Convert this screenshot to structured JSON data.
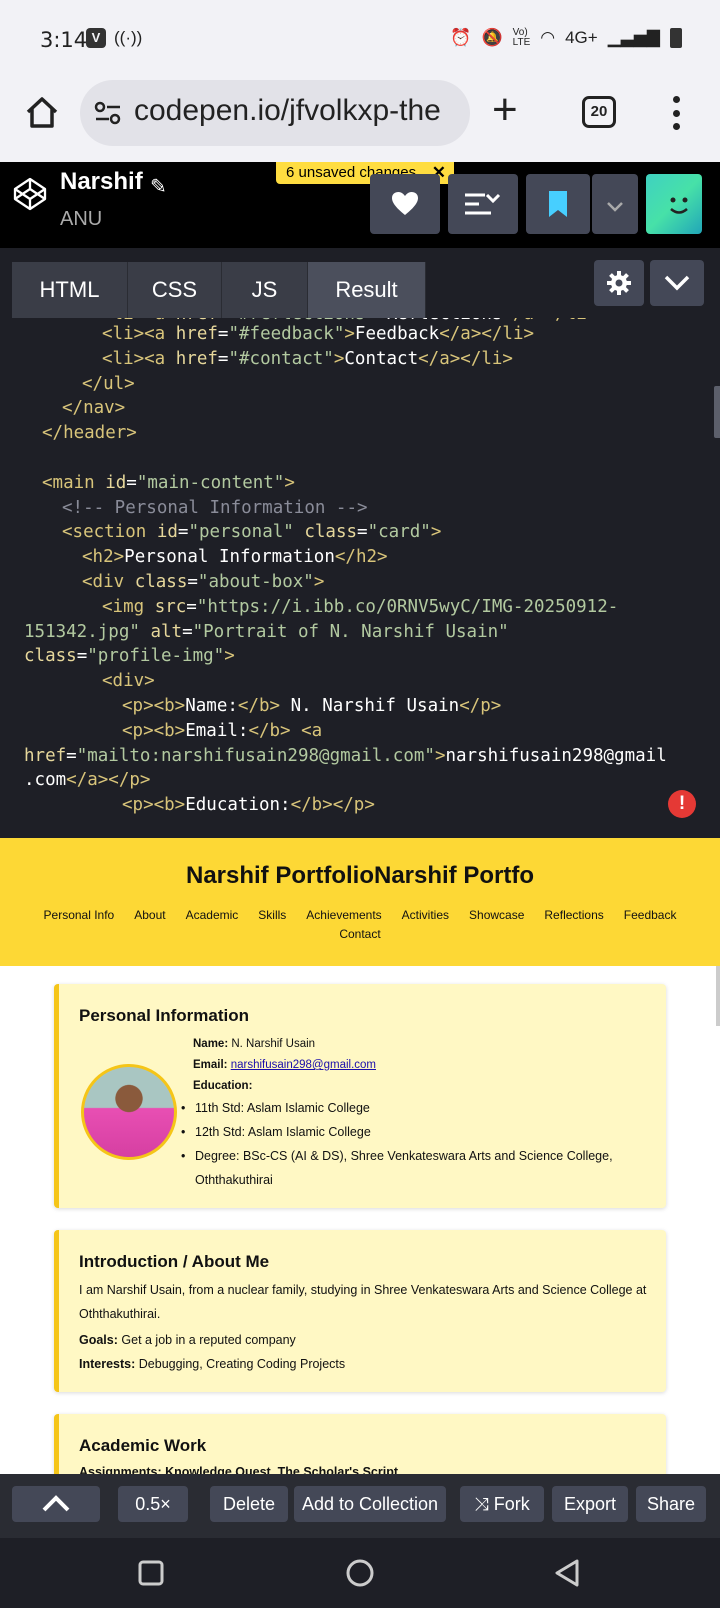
{
  "status_bar": {
    "time": "3:14",
    "app_badge": "V",
    "network": "4G+",
    "icons": [
      "vpn-icon",
      "hotspot-icon",
      "alarm-icon",
      "mute-icon",
      "volte-icon",
      "wifi-calling-icon",
      "signal-icon",
      "battery-icon"
    ]
  },
  "browser": {
    "url": "codepen.io/jfvolkxp-the",
    "tab_count": "20"
  },
  "codepen": {
    "pen_title": "Narshif",
    "username": "ANU",
    "unsaved": "6 unsaved changes",
    "tabs": [
      "HTML",
      "CSS",
      "JS",
      "Result"
    ]
  },
  "code_lines": [
    {
      "parts": [
        [
          "tg",
          "<li><a "
        ],
        [
          "at",
          "href"
        ],
        [
          "tx",
          "="
        ],
        [
          "st",
          "\"#feedback\""
        ],
        [
          "tg",
          ">"
        ],
        [
          "tx",
          "Feedback"
        ],
        [
          "tg",
          "</a></li>"
        ]
      ]
    },
    {
      "parts": [
        [
          "tg",
          "<li><a "
        ],
        [
          "at",
          "href"
        ],
        [
          "tx",
          "="
        ],
        [
          "st",
          "\"#contact\""
        ],
        [
          "tg",
          ">"
        ],
        [
          "tx",
          "Contact"
        ],
        [
          "tg",
          "</a></li>"
        ]
      ]
    },
    {
      "parts": [
        [
          "tg",
          "</ul>"
        ]
      ]
    },
    {
      "parts": [
        [
          "tg",
          "</nav>"
        ]
      ]
    },
    {
      "parts": [
        [
          "tg",
          "</header>"
        ]
      ]
    },
    {
      "parts": []
    },
    {
      "parts": [
        [
          "tg",
          "<main "
        ],
        [
          "at",
          "id"
        ],
        [
          "tx",
          "="
        ],
        [
          "st",
          "\"main-content\""
        ],
        [
          "tg",
          ">"
        ]
      ]
    },
    {
      "parts": [
        [
          "cm",
          "<!-- Personal Information -->"
        ]
      ]
    },
    {
      "parts": [
        [
          "tg",
          "<section "
        ],
        [
          "at",
          "id"
        ],
        [
          "tx",
          "="
        ],
        [
          "st",
          "\"personal\""
        ],
        [
          "tx",
          " "
        ],
        [
          "at",
          "class"
        ],
        [
          "tx",
          "="
        ],
        [
          "st",
          "\"card\""
        ],
        [
          "tg",
          ">"
        ]
      ]
    },
    {
      "parts": [
        [
          "tg",
          "<h2>"
        ],
        [
          "tx",
          "Personal Information"
        ],
        [
          "tg",
          "</h2>"
        ]
      ]
    },
    {
      "parts": [
        [
          "tg",
          "<div "
        ],
        [
          "at",
          "class"
        ],
        [
          "tx",
          "="
        ],
        [
          "st",
          "\"about-box\""
        ],
        [
          "tg",
          ">"
        ]
      ]
    },
    {
      "parts": [
        [
          "tg",
          "<img "
        ],
        [
          "at",
          "src"
        ],
        [
          "tx",
          "="
        ],
        [
          "st",
          "\"https://i.ibb.co/0RNV5wyC/IMG-20250912-"
        ]
      ]
    },
    {
      "parts": [
        [
          "st",
          "151342.jpg\""
        ],
        [
          "tx",
          " "
        ],
        [
          "at",
          "alt"
        ],
        [
          "tx",
          "="
        ],
        [
          "st",
          "\"Portrait of N. Narshif Usain\""
        ]
      ]
    },
    {
      "parts": [
        [
          "at",
          "class"
        ],
        [
          "tx",
          "="
        ],
        [
          "st",
          "\"profile-img\""
        ],
        [
          "tg",
          ">"
        ]
      ]
    },
    {
      "parts": [
        [
          "tg",
          "<div>"
        ]
      ]
    },
    {
      "parts": [
        [
          "tg",
          "<p><b>"
        ],
        [
          "tx",
          "Name:"
        ],
        [
          "tg",
          "</b>"
        ],
        [
          "tx",
          " N. Narshif Usain"
        ],
        [
          "tg",
          "</p>"
        ]
      ]
    },
    {
      "parts": [
        [
          "tg",
          "<p><b>"
        ],
        [
          "tx",
          "Email:"
        ],
        [
          "tg",
          "</b>"
        ],
        [
          "tx",
          " "
        ],
        [
          "tg",
          "<a"
        ]
      ]
    },
    {
      "parts": [
        [
          "at",
          "href"
        ],
        [
          "tx",
          "="
        ],
        [
          "st",
          "\"mailto:narshifusain298@gmail.com\""
        ],
        [
          "tg",
          ">"
        ],
        [
          "tx",
          "narshifusain298@gmail"
        ]
      ]
    },
    {
      "parts": [
        [
          "tx",
          ".com"
        ],
        [
          "tg",
          "</a></p>"
        ]
      ]
    },
    {
      "parts": [
        [
          "tg",
          "<p><b>"
        ],
        [
          "tx",
          "Education:"
        ],
        [
          "tg",
          "</b></p>"
        ]
      ]
    }
  ],
  "result": {
    "site_title": "Narshif PortfolioNarshif Portfo",
    "nav": [
      "Personal Info",
      "About",
      "Academic",
      "Skills",
      "Achievements",
      "Activities",
      "Showcase",
      "Reflections",
      "Feedback",
      "Contact"
    ],
    "personal": {
      "heading": "Personal Information",
      "name_label": "Name:",
      "name": "N. Narshif Usain",
      "email_label": "Email:",
      "email": "narshifusain298@gmail.com",
      "education_label": "Education:",
      "education": [
        "11th Std: Aslam Islamic College",
        "12th Std: Aslam Islamic College",
        "Degree: BSc-CS (AI & DS), Shree Venkateswara Arts and Science College, Oththakuthirai"
      ]
    },
    "about": {
      "heading": "Introduction / About Me",
      "text": "I am Narshif Usain, from a nuclear family, studying in Shree Venkateswara Arts and Science College at Oththakuthirai.",
      "goals_label": "Goals:",
      "goals": "Get a job in a reputed company",
      "interests_label": "Interests:",
      "interests": "Debugging, Creating Coding Projects"
    },
    "academic": {
      "heading": "Academic Work",
      "partial_line": "Assignments: Knowledge Quest, The Scholar's Script"
    }
  },
  "toolbar": {
    "zoom": "0.5×",
    "delete": "Delete",
    "add_collection": "Add to Collection",
    "fork": "Fork",
    "export": "Export",
    "share": "Share"
  },
  "colors": {
    "accent_yellow": "#fdd835",
    "editor_bg": "#1e1f26",
    "card_bg": "#fff8c4"
  }
}
